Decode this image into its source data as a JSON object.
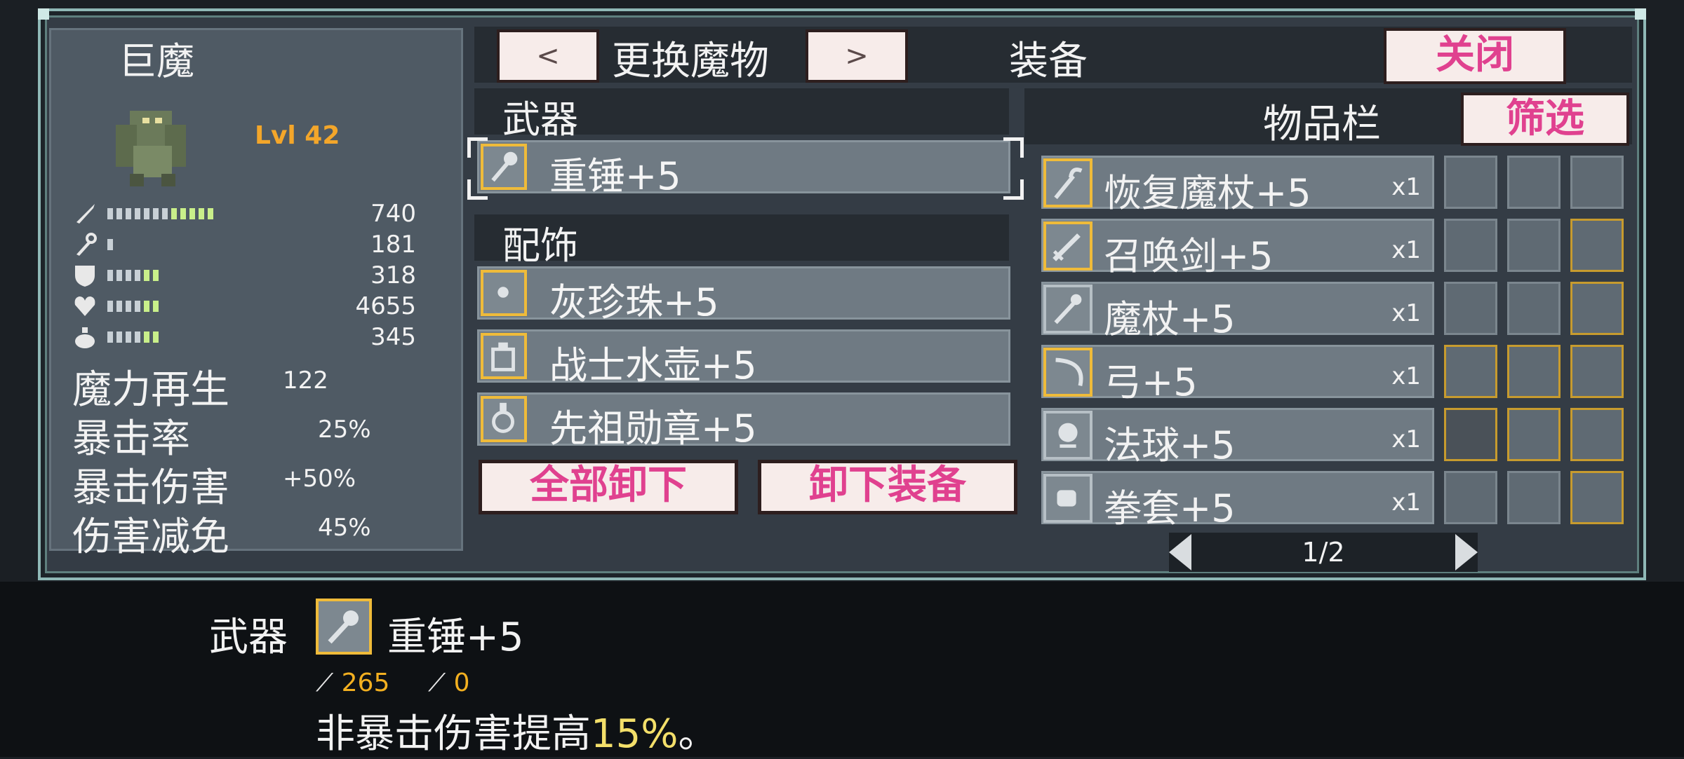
{
  "monster": {
    "name": "巨魔",
    "level": "Lvl 42",
    "stats": [
      {
        "icon": "sword-icon",
        "value": "740"
      },
      {
        "icon": "wand-icon",
        "value": "181"
      },
      {
        "icon": "shield-icon",
        "value": "318"
      },
      {
        "icon": "heart-icon",
        "value": "4655"
      },
      {
        "icon": "potion-icon",
        "value": "345"
      }
    ],
    "text_stats": [
      {
        "label": "魔力再生",
        "value": "122"
      },
      {
        "label": "暴击率",
        "value": "25%"
      },
      {
        "label": "暴击伤害",
        "value": "+50%"
      },
      {
        "label": "伤害减免",
        "value": "45%"
      }
    ]
  },
  "topbar": {
    "prev_label": "<",
    "switch_label": "更换魔物",
    "next_label": ">",
    "title": "装备",
    "close_label": "关闭"
  },
  "equipment": {
    "weapon_header": "武器",
    "weapon": {
      "name": "重锤+5",
      "icon": "mace-icon"
    },
    "accessory_header": "配饰",
    "accessories": [
      {
        "name": "灰珍珠+5",
        "icon": "pearl-icon"
      },
      {
        "name": "战士水壶+5",
        "icon": "flask-icon"
      },
      {
        "name": "先祖勋章+5",
        "icon": "medal-icon"
      }
    ],
    "unequip_all_label": "全部卸下",
    "unequip_label": "卸下装备"
  },
  "inventory": {
    "title": "物品栏",
    "filter_label": "筛选",
    "items": [
      {
        "name": "恢复魔杖+5",
        "qty": "x1",
        "icon": "hook-staff-icon",
        "gold": true
      },
      {
        "name": "召唤剑+5",
        "qty": "x1",
        "icon": "sword-icon",
        "gold": true
      },
      {
        "name": "魔杖+5",
        "qty": "x1",
        "icon": "wand-icon",
        "gold": false
      },
      {
        "name": "弓+5",
        "qty": "x1",
        "icon": "bow-icon",
        "gold": true
      },
      {
        "name": "法球+5",
        "qty": "x1",
        "icon": "orb-icon",
        "gold": false
      },
      {
        "name": "拳套+5",
        "qty": "x1",
        "icon": "gauntlet-icon",
        "gold": false
      }
    ],
    "page": "1/2"
  },
  "detail": {
    "section": "武器",
    "item_name": "重锤+5",
    "atk": "265",
    "matk": "0",
    "desc_prefix": "非暴击伤害提高",
    "desc_value": "15%",
    "desc_suffix": "。"
  },
  "colors": {
    "accent_gold": "#efbb3a",
    "button_pink": "#e0418f",
    "panel": "#343c45"
  }
}
